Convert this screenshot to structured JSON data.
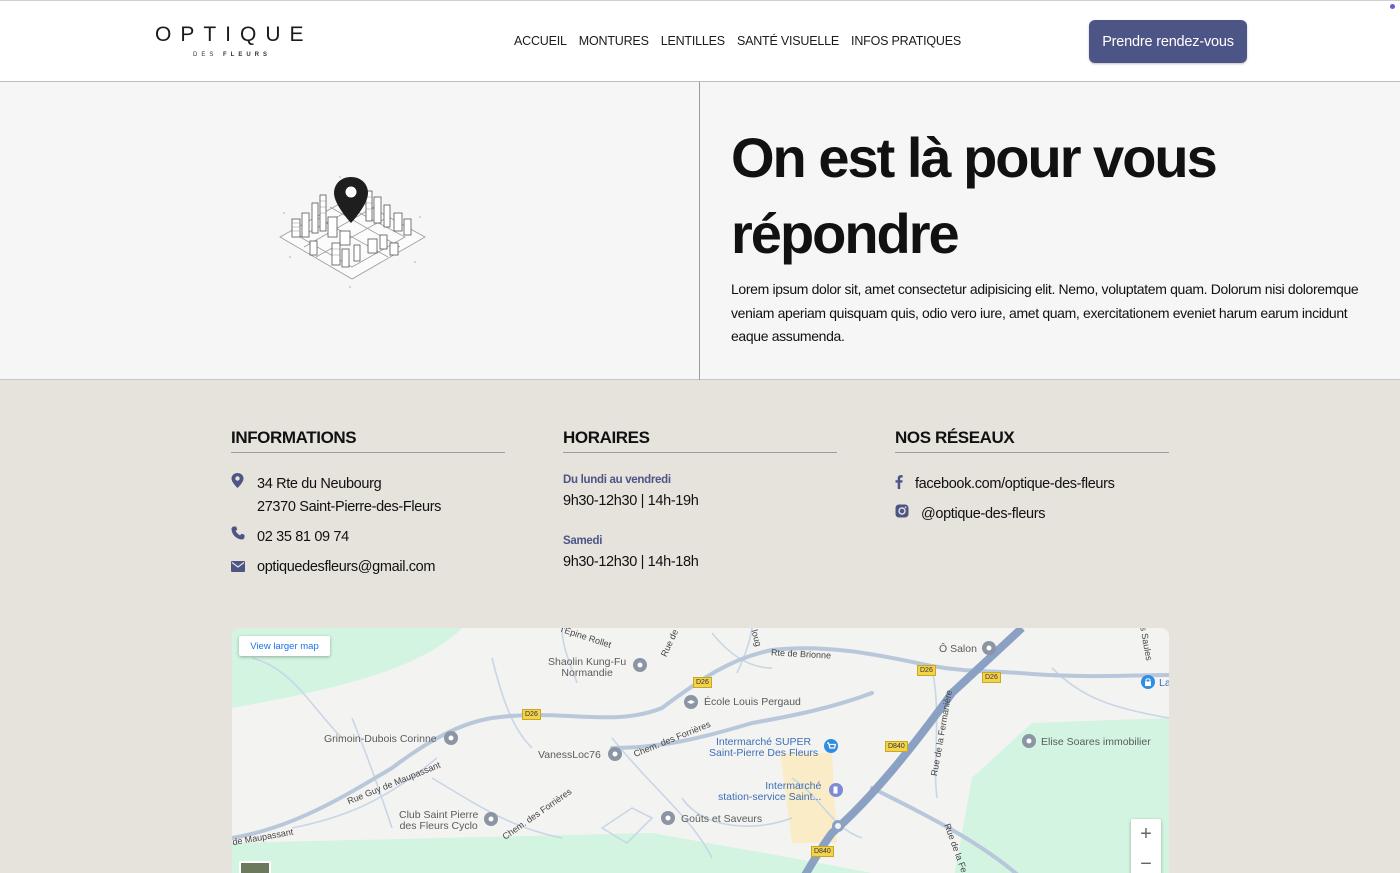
{
  "brand": {
    "logo_main": "OPTIQUE",
    "logo_sub_a": "DES",
    "logo_sub_b": "FLEURS"
  },
  "nav": {
    "items": [
      "ACCUEIL",
      "MONTURES",
      "LENTILLES",
      "SANTÉ VISUELLE",
      "INFOS PRATIQUES"
    ]
  },
  "header": {
    "cta_label": "Prendre rendez-vous"
  },
  "hero": {
    "title": "On est là pour vous répondre",
    "text": "Lorem ipsum dolor sit, amet consectetur adipisicing elit. Nemo, voluptatem quam. Dolorum nisi doloremque veniam aperiam quisquam quis, odio vero iure, amet quam, exercitationem eveniet harum earum incidunt eaque assumenda."
  },
  "info": {
    "title": "INFORMATIONS",
    "address_line1": "34 Rte du Neubourg",
    "address_line2": "27370 Saint-Pierre-des-Fleurs",
    "phone": "02 35 81 09 74",
    "email": "optiquedesfleurs@gmail.com"
  },
  "hours": {
    "title": "HORAIRES",
    "weekday_label": "Du lundi au vendredi",
    "weekday_hours": "9h30-12h30 | 14h-19h",
    "saturday_label": "Samedi",
    "saturday_hours": "9h30-12h30 | 14h-18h"
  },
  "social": {
    "title": "NOS RÉSEAUX",
    "facebook": "facebook.com/optique-des-fleurs",
    "instagram": "@optique-des-fleurs"
  },
  "map": {
    "larger_map": "View larger map",
    "zoom_in": "+",
    "zoom_out": "−",
    "places": {
      "shaolin_1": "Shaolin Kung-Fu",
      "shaolin_2": "Normandie",
      "ecole": "École Louis Pergaud",
      "grimoin": "Grimoin-Dubois Corinne",
      "vaness": "VanessLoc76",
      "intermarche_super_1": "Intermarché SUPER",
      "intermarche_super_2": "Saint-Pierre Des Fleurs",
      "intermarche_station_1": "Intermarché",
      "intermarche_station_2": "station-service Saint...",
      "club_1": "Club Saint Pierre",
      "club_2": "des Fleurs Cyclo",
      "gouts": "Goûts et Saveurs",
      "osalon": "Ô Salon",
      "elise": "Elise Soares immobilier",
      "la": "La"
    },
    "roads": {
      "rte_brionne": "Rte de Brionne",
      "rue_maupassant": "Rue Guy de Maupassant",
      "de_maupassant": "de Maupassant",
      "chem_forrieres_1": "Chem. des Forrières",
      "chem_forrieres_2": "Chem. des Forrières",
      "epine_rollet": "l'Épine Rollet",
      "rue_de": "Rue de",
      "ioug": "loug",
      "rue_fermaniere": "Rue de la Fermanière",
      "rue_fe": "Rue de la Fe",
      "saules": "es Saules"
    },
    "shields": {
      "d26": "D26",
      "d840": "D840"
    }
  },
  "colors": {
    "accent": "#4d5587",
    "footer_bg": "#e6e2dc",
    "hero_bg": "#f6f6f6"
  }
}
